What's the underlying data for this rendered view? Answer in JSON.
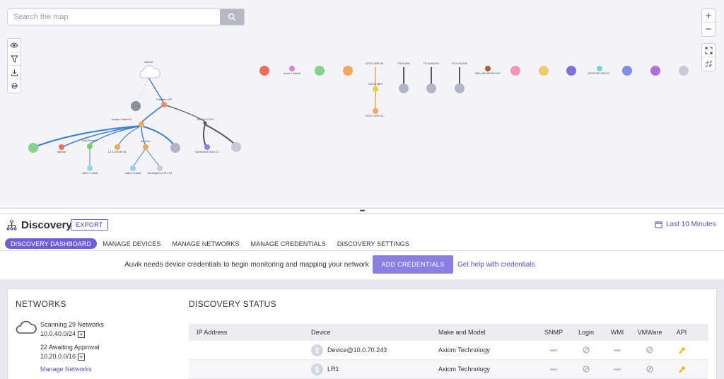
{
  "search": {
    "placeholder": "Search the map"
  },
  "map": {
    "labels": {
      "internet": "Internet",
      "l_a": "Fortigate-ATP",
      "l_b": "Juniper-Juniper01",
      "l_c": "FirePub 3.0.64",
      "l_d": "pfsense",
      "l_e": "Ubiq-Frame01",
      "l_f": "Ubiq-Frame01",
      "l_g": "L3 4-105-BP-84",
      "l_h": "Ax-Core",
      "l_i": "Device@10.254.1.12",
      "l_j": "unifi-lr-0 ulnab",
      "l_k": "unifi-lr-0 ulnab",
      "l_l": "Device@10.4.75.1.33",
      "l_m": "aruba-1-68ab6",
      "l_n": "CISCO-4BP1 M...",
      "l_o": "CISCO-4BP1",
      "l_p": "CISCO-4BP1 M...",
      "l_q": "FS-0LAN8",
      "l_r": "FS-0LAN4GE",
      "l_s": "FS-0LAN4GE",
      "l_t": "WIN-UDHJHHS07H07",
      "l_u": "DESKTOP-F5CCS..."
    }
  },
  "discovery": {
    "title": "Discovery",
    "export": "EXPORT",
    "time_range": "Last 10 Minutes"
  },
  "tabs": [
    {
      "label": "DISCOVERY DASHBOARD"
    },
    {
      "label": "MANAGE DEVICES"
    },
    {
      "label": "MANAGE NETWORKS"
    },
    {
      "label": "MANAGE CREDENTIALS"
    },
    {
      "label": "DISCOVERY SETTINGS"
    }
  ],
  "banner": {
    "text": "Auvik needs device credentials to begin monitoring and mapping your network",
    "button": "ADD CREDENTIALS",
    "help": "Get help with credentials"
  },
  "networks": {
    "title": "NETWORKS",
    "scanning": "Scanning 29 Networks",
    "scan_net": "10.0.40.0/24",
    "awaiting": "22 Awaiting Approval",
    "await_net": "10.20.0.0/16",
    "manage": "Manage Networks"
  },
  "discovery_status": {
    "title": "DISCOVERY STATUS",
    "columns": {
      "ip": "IP Address",
      "device": "Device",
      "make": "Make and Model",
      "snmp": "SNMP",
      "login": "Login",
      "wmi": "WMI",
      "vmware": "VMWare",
      "api": "API"
    },
    "rows": [
      {
        "ip": "",
        "device": "Device@10.0.70.243",
        "make": "Axiom Technology"
      },
      {
        "ip": "",
        "device": "LR1",
        "make": "Axiom Technology"
      }
    ]
  },
  "colors": {
    "accent": "#6e5fd8",
    "link": "#5b4bd0",
    "key": "#f0b400"
  }
}
